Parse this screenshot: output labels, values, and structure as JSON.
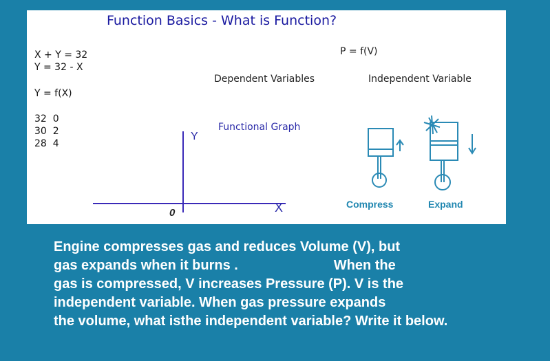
{
  "slide": {
    "title": "Function Basics - What is Function?",
    "equations": [
      "X + Y = 32",
      "Y = 32 - X",
      "Y = f(X)"
    ],
    "table": [
      "32  0",
      "30  2",
      "28  4"
    ],
    "pv": "P = f(V)",
    "dependent": "Dependent Variables",
    "independent": "Independent Variable",
    "graph_title": "Functional Graph",
    "axis_y": "Y",
    "axis_x": "X",
    "origin": "0",
    "compress": "Compress",
    "expand": "Expand"
  },
  "body": {
    "lines": [
      "Engine compresses gas and reduces Volume (V), but",
      "gas expands when it burns .                         When the",
      "gas is compressed, V increases Pressure (P). V is the",
      "independent variable. When gas pressure expands",
      "the volume, what isthe independent variable? Write it below."
    ]
  }
}
